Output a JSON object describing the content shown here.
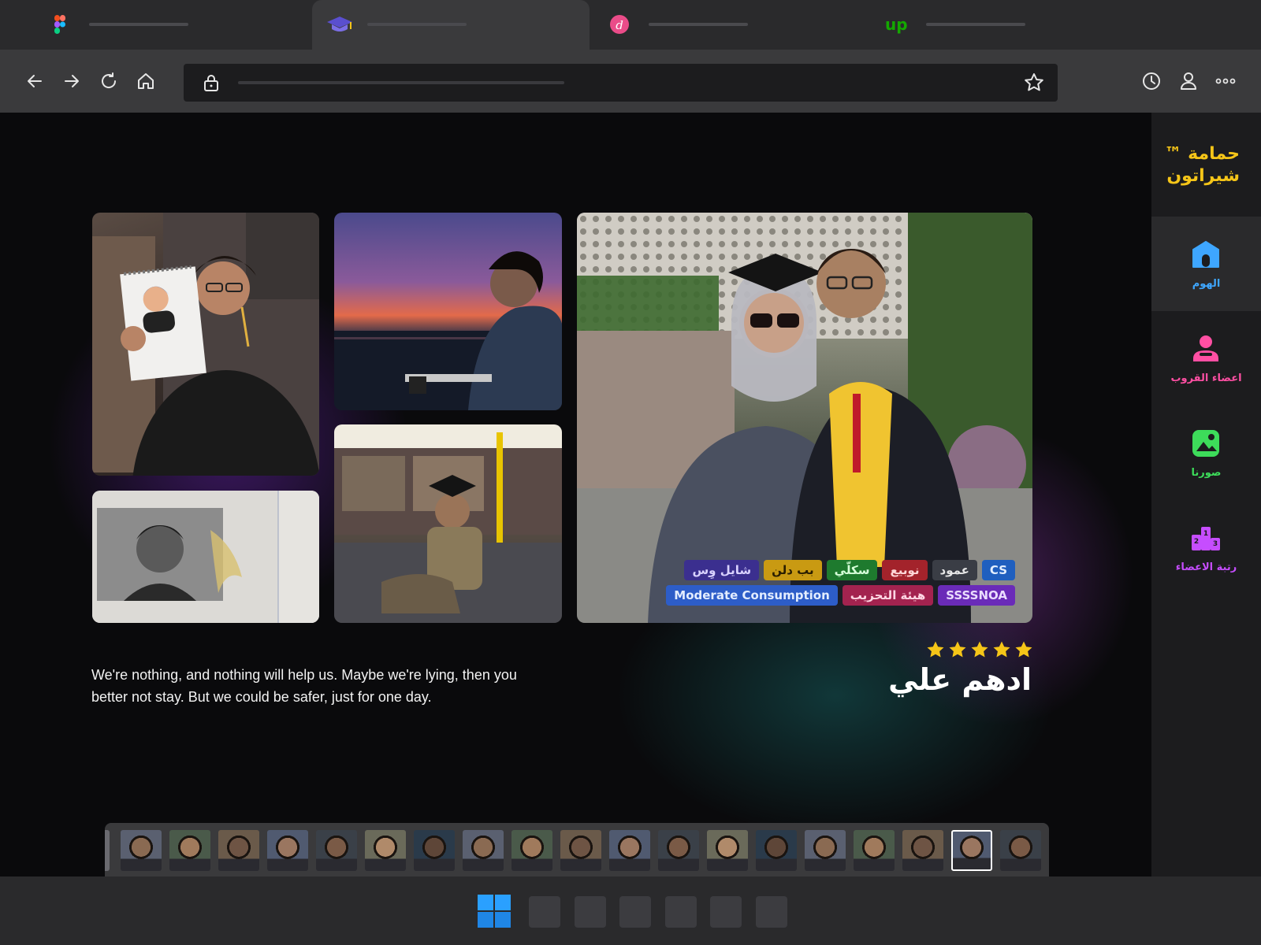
{
  "browser": {
    "tabs": [
      {
        "icon": "figma-icon",
        "active": false
      },
      {
        "icon": "graduation-cap-icon",
        "active": true
      },
      {
        "icon": "dribbble-icon",
        "active": false
      },
      {
        "icon": "upwork-icon",
        "active": false
      }
    ],
    "toolbar": {
      "buttons": [
        "back-icon",
        "forward-icon",
        "reload-icon",
        "home-icon"
      ],
      "right_buttons": [
        "history-icon",
        "profile-icon",
        "more-icon"
      ]
    }
  },
  "sidebar": {
    "brand_line1": "حمامة ™",
    "brand_line2": "شيراتون",
    "items": [
      {
        "label": "الهوم",
        "icon": "home-icon",
        "color": "#3ea6ff",
        "active": true
      },
      {
        "label": "اعضاء القروب",
        "icon": "person-icon",
        "color": "#ff4fa3",
        "active": false
      },
      {
        "label": "صورنا",
        "icon": "image-icon",
        "color": "#3ddc5a",
        "active": false
      },
      {
        "label": "رتبة الاعضاء",
        "icon": "podium-icon",
        "color": "#c64dff",
        "active": false
      }
    ]
  },
  "profile": {
    "name": "ادهم علي",
    "rating": 5,
    "quote": "We're nothing, and nothing will help us. Maybe we're lying, then you better not stay. But we could be safer, just for one day.",
    "tags_row1": [
      {
        "text": "شايل وِس",
        "bg": "#3b2f8f",
        "fg": "#d9d2ff"
      },
      {
        "text": "بب دلن",
        "bg": "#c99a12",
        "fg": "#2a1e00"
      },
      {
        "text": "سكلّي",
        "bg": "#1e7a2e",
        "fg": "#d6ffd9"
      },
      {
        "text": "نوبيع",
        "bg": "#a3232b",
        "fg": "#ffd6d6"
      },
      {
        "text": "عمود",
        "bg": "#3a3d45",
        "fg": "#e6e6e6"
      },
      {
        "text": "CS",
        "bg": "#1f5fbf",
        "fg": "#e3efff"
      }
    ],
    "tags_row2": [
      {
        "text": "Moderate Consumption",
        "bg": "#2d5dc8",
        "fg": "#e3edff"
      },
      {
        "text": "هيئة التحزيب",
        "bg": "#a3234f",
        "fg": "#ffd6e3"
      },
      {
        "text": "SSSSNOA",
        "bg": "#6a2bb8",
        "fg": "#eadcff"
      }
    ]
  },
  "strip": {
    "count": 19,
    "selected_index": 17
  },
  "taskbar": {
    "start_icon": "windows-icon",
    "apps": 6
  }
}
